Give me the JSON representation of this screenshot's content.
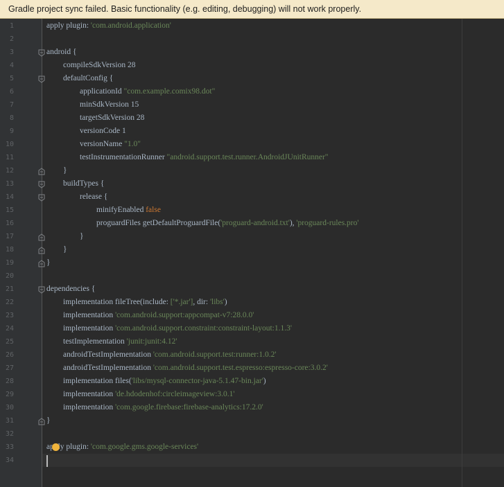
{
  "banner": {
    "message": "Gradle project sync failed. Basic functionality (e.g. editing, debugging) will not work properly."
  },
  "editor": {
    "lines": [
      {
        "n": "1",
        "indent": 0,
        "fold": "",
        "segs": [
          {
            "t": "apply plugin: ",
            "c": "plain"
          },
          {
            "t": "'com.android.application'",
            "c": "str"
          }
        ]
      },
      {
        "n": "2",
        "indent": 0,
        "fold": "",
        "segs": []
      },
      {
        "n": "3",
        "indent": 0,
        "fold": "open",
        "segs": [
          {
            "t": "android {",
            "c": "plain"
          }
        ]
      },
      {
        "n": "4",
        "indent": 1,
        "fold": "",
        "segs": [
          {
            "t": "compileSdkVersion 28",
            "c": "plain"
          }
        ]
      },
      {
        "n": "5",
        "indent": 1,
        "fold": "open",
        "segs": [
          {
            "t": "defaultConfig {",
            "c": "plain"
          }
        ]
      },
      {
        "n": "6",
        "indent": 2,
        "fold": "",
        "segs": [
          {
            "t": "applicationId ",
            "c": "plain"
          },
          {
            "t": "\"com.example.comix98.dot\"",
            "c": "str"
          }
        ]
      },
      {
        "n": "7",
        "indent": 2,
        "fold": "",
        "segs": [
          {
            "t": "minSdkVersion 15",
            "c": "plain"
          }
        ]
      },
      {
        "n": "8",
        "indent": 2,
        "fold": "",
        "segs": [
          {
            "t": "targetSdkVersion 28",
            "c": "plain"
          }
        ]
      },
      {
        "n": "9",
        "indent": 2,
        "fold": "",
        "segs": [
          {
            "t": "versionCode 1",
            "c": "plain"
          }
        ]
      },
      {
        "n": "10",
        "indent": 2,
        "fold": "",
        "segs": [
          {
            "t": "versionName ",
            "c": "plain"
          },
          {
            "t": "\"1.0\"",
            "c": "str"
          }
        ]
      },
      {
        "n": "11",
        "indent": 2,
        "fold": "",
        "segs": [
          {
            "t": "testInstrumentationRunner ",
            "c": "plain"
          },
          {
            "t": "\"android.support.test.runner.AndroidJUnitRunner\"",
            "c": "str"
          }
        ]
      },
      {
        "n": "12",
        "indent": 1,
        "fold": "close",
        "segs": [
          {
            "t": "}",
            "c": "plain"
          }
        ]
      },
      {
        "n": "13",
        "indent": 1,
        "fold": "open",
        "segs": [
          {
            "t": "buildTypes {",
            "c": "plain"
          }
        ]
      },
      {
        "n": "14",
        "indent": 2,
        "fold": "open",
        "segs": [
          {
            "t": "release {",
            "c": "plain"
          }
        ]
      },
      {
        "n": "15",
        "indent": 3,
        "fold": "",
        "segs": [
          {
            "t": "minifyEnabled ",
            "c": "plain"
          },
          {
            "t": "false",
            "c": "kw"
          }
        ]
      },
      {
        "n": "16",
        "indent": 3,
        "fold": "",
        "segs": [
          {
            "t": "proguardFiles getDefaultProguardFile(",
            "c": "plain"
          },
          {
            "t": "'proguard-android.txt'",
            "c": "str"
          },
          {
            "t": "), ",
            "c": "plain"
          },
          {
            "t": "'proguard-rules.pro'",
            "c": "str"
          }
        ]
      },
      {
        "n": "17",
        "indent": 2,
        "fold": "close",
        "segs": [
          {
            "t": "}",
            "c": "plain"
          }
        ]
      },
      {
        "n": "18",
        "indent": 1,
        "fold": "close",
        "segs": [
          {
            "t": "}",
            "c": "plain"
          }
        ]
      },
      {
        "n": "19",
        "indent": 0,
        "fold": "close",
        "segs": [
          {
            "t": "}",
            "c": "plain"
          }
        ]
      },
      {
        "n": "20",
        "indent": 0,
        "fold": "",
        "segs": []
      },
      {
        "n": "21",
        "indent": 0,
        "fold": "open",
        "segs": [
          {
            "t": "dependencies {",
            "c": "plain"
          }
        ]
      },
      {
        "n": "22",
        "indent": 1,
        "fold": "",
        "segs": [
          {
            "t": "implementation fileTree(",
            "c": "plain"
          },
          {
            "t": "include: ",
            "c": "plain"
          },
          {
            "t": "['*.jar']",
            "c": "str"
          },
          {
            "t": ", ",
            "c": "plain"
          },
          {
            "t": "dir: ",
            "c": "plain"
          },
          {
            "t": "'libs'",
            "c": "str"
          },
          {
            "t": ")",
            "c": "plain"
          }
        ]
      },
      {
        "n": "23",
        "indent": 1,
        "fold": "",
        "segs": [
          {
            "t": "implementation ",
            "c": "plain"
          },
          {
            "t": "'com.android.support:appcompat-v7:28.0.0'",
            "c": "str"
          }
        ]
      },
      {
        "n": "24",
        "indent": 1,
        "fold": "",
        "segs": [
          {
            "t": "implementation ",
            "c": "plain"
          },
          {
            "t": "'com.android.support.constraint:constraint-layout:1.1.3'",
            "c": "str"
          }
        ]
      },
      {
        "n": "25",
        "indent": 1,
        "fold": "",
        "segs": [
          {
            "t": "testImplementation ",
            "c": "plain"
          },
          {
            "t": "'junit:junit:4.12'",
            "c": "str"
          }
        ]
      },
      {
        "n": "26",
        "indent": 1,
        "fold": "",
        "segs": [
          {
            "t": "androidTestImplementation ",
            "c": "plain"
          },
          {
            "t": "'com.android.support.test:runner:1.0.2'",
            "c": "str"
          }
        ]
      },
      {
        "n": "27",
        "indent": 1,
        "fold": "",
        "segs": [
          {
            "t": "androidTestImplementation ",
            "c": "plain"
          },
          {
            "t": "'com.android.support.test.espresso:espresso-core:3.0.2'",
            "c": "str"
          }
        ]
      },
      {
        "n": "28",
        "indent": 1,
        "fold": "",
        "segs": [
          {
            "t": "implementation files(",
            "c": "plain"
          },
          {
            "t": "'libs/mysql-connector-java-5.1.47-bin.jar'",
            "c": "str"
          },
          {
            "t": ")",
            "c": "plain"
          }
        ]
      },
      {
        "n": "29",
        "indent": 1,
        "fold": "",
        "segs": [
          {
            "t": "implementation ",
            "c": "plain"
          },
          {
            "t": "'de.hdodenhof:circleimageview:3.0.1'",
            "c": "str"
          }
        ]
      },
      {
        "n": "30",
        "indent": 1,
        "fold": "",
        "segs": [
          {
            "t": "implementation ",
            "c": "plain"
          },
          {
            "t": "'com.google.firebase:firebase-analytics:17.2.0'",
            "c": "str"
          }
        ]
      },
      {
        "n": "31",
        "indent": 0,
        "fold": "close",
        "segs": [
          {
            "t": "}",
            "c": "plain"
          }
        ]
      },
      {
        "n": "32",
        "indent": 0,
        "fold": "",
        "segs": []
      },
      {
        "n": "33",
        "indent": 0,
        "fold": "",
        "bulb": true,
        "segs": [
          {
            "t": "apply plugin: ",
            "c": "plain"
          },
          {
            "t": "'com.google.gms.google-services'",
            "c": "str"
          }
        ]
      },
      {
        "n": "34",
        "indent": 0,
        "fold": "",
        "caret": true,
        "segs": []
      }
    ]
  },
  "colors": {
    "background": "#2b2b2b",
    "gutter": "#313335",
    "plain_text": "#a9b7c6",
    "keyword": "#cc7832",
    "string": "#6a8759",
    "banner": "#f5e9c9"
  }
}
